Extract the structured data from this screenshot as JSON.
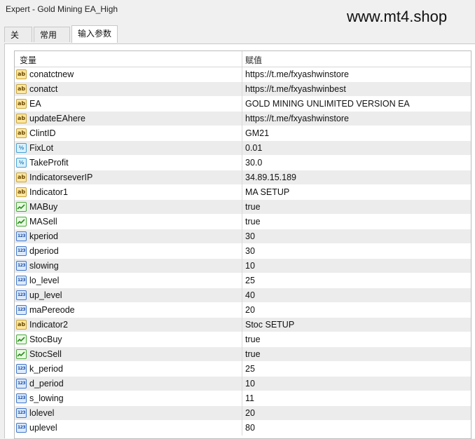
{
  "window": {
    "title": "Expert - Gold Mining EA_High"
  },
  "watermark": "www.mt4.shop",
  "tabs": [
    {
      "label": "关于"
    },
    {
      "label": "常用"
    },
    {
      "label": "输入参数"
    }
  ],
  "table": {
    "headers": {
      "variable": "变量",
      "value": "赋值"
    },
    "rows": [
      {
        "type": "string",
        "name": "conatctnew",
        "value": "https://t.me/fxyashwinstore"
      },
      {
        "type": "string",
        "name": "conatct",
        "value": "https://t.me/fxyashwinbest"
      },
      {
        "type": "string",
        "name": "EA",
        "value": "GOLD MINING UNLIMITED VERSION EA"
      },
      {
        "type": "string",
        "name": "updateEAhere",
        "value": "https://t.me/fxyashwinstore"
      },
      {
        "type": "string",
        "name": "ClintID",
        "value": "GM21"
      },
      {
        "type": "double",
        "name": "FixLot",
        "value": "0.01"
      },
      {
        "type": "double",
        "name": "TakeProfit",
        "value": "30.0"
      },
      {
        "type": "string",
        "name": "IndicatorseverIP",
        "value": "34.89.15.189"
      },
      {
        "type": "string",
        "name": "Indicator1",
        "value": "MA SETUP"
      },
      {
        "type": "bool",
        "name": "MABuy",
        "value": "true"
      },
      {
        "type": "bool",
        "name": "MASell",
        "value": "true"
      },
      {
        "type": "int",
        "name": "kperiod",
        "value": "30"
      },
      {
        "type": "int",
        "name": "dperiod",
        "value": "30"
      },
      {
        "type": "int",
        "name": "slowing",
        "value": "10"
      },
      {
        "type": "int",
        "name": "lo_level",
        "value": "25"
      },
      {
        "type": "int",
        "name": "up_level",
        "value": "40"
      },
      {
        "type": "int",
        "name": "maPereode",
        "value": "20"
      },
      {
        "type": "string",
        "name": "Indicator2",
        "value": "Stoc SETUP"
      },
      {
        "type": "bool",
        "name": "StocBuy",
        "value": "true"
      },
      {
        "type": "bool",
        "name": "StocSell",
        "value": "true"
      },
      {
        "type": "int",
        "name": "k_period",
        "value": "25"
      },
      {
        "type": "int",
        "name": "d_period",
        "value": "10"
      },
      {
        "type": "int",
        "name": "s_lowing",
        "value": "11"
      },
      {
        "type": "int",
        "name": "lolevel",
        "value": "20"
      },
      {
        "type": "int",
        "name": "uplevel",
        "value": "80"
      }
    ]
  },
  "icons": {
    "string": "ab-string-icon",
    "double": "double-type-icon",
    "int": "int-type-icon",
    "bool": "bool-type-icon"
  },
  "colors": {
    "alt_row": "#ececec"
  }
}
